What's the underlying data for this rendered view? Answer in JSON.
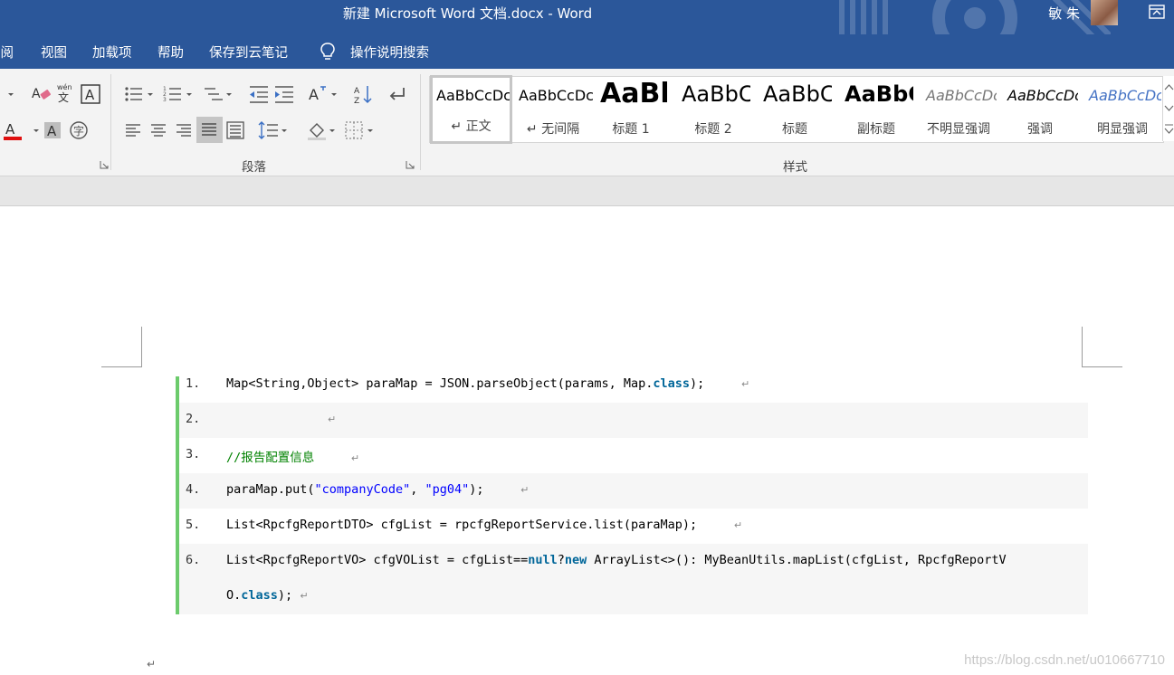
{
  "window": {
    "title": "新建 Microsoft Word 文档.docx  -  Word",
    "user": "敏 朱"
  },
  "tabs": [
    "审阅",
    "视图",
    "加载项",
    "帮助",
    "保存到云笔记",
    "操作说明搜索"
  ],
  "ribbon": {
    "paragraph_group_label": "段落",
    "styles_group_label": "样式",
    "styles": [
      {
        "preview": "AaBbCcDc",
        "name": "↵ 正文"
      },
      {
        "preview": "AaBbCcDc",
        "name": "↵ 无间隔"
      },
      {
        "preview": "AaBl",
        "name": "标题 1"
      },
      {
        "preview": "AaBbC",
        "name": "标题 2"
      },
      {
        "preview": "AaBbC",
        "name": "标题"
      },
      {
        "preview": "AaBbC",
        "name": "副标题"
      },
      {
        "preview": "AaBbCcDc",
        "name": "不明显强调"
      },
      {
        "preview": "AaBbCcDc",
        "name": "强调"
      },
      {
        "preview": "AaBbCcDc",
        "name": "明显强调"
      }
    ]
  },
  "code": {
    "accent_color": "#6ccb6c",
    "lines": [
      {
        "num": "1."
      },
      {
        "num": "2."
      },
      {
        "num": "3."
      },
      {
        "num": "4."
      },
      {
        "num": "5."
      },
      {
        "num": "6."
      }
    ],
    "tokens": {
      "l1a": "Map<String,Object> paraMap = JSON.parseObject(params, Map.",
      "l1kw": "class",
      "l1b": ");",
      "l3": "//报告配置信息",
      "l4a": "paraMap.put(",
      "l4s1": "\"companyCode\"",
      "l4b": ", ",
      "l4s2": "\"pg04\"",
      "l4c": ");",
      "l5": "List<RpcfgReportDTO> cfgList = rpcfgReportService.list(paraMap);",
      "l6a": "List<RpcfgReportVO> cfgVOList = cfgList==",
      "l6kw1": "null",
      "l6b": "?",
      "l6kw2": "new",
      "l6c": " ArrayList<>(): MyBeanUtils.mapList(cfgList, RpcfgReportV",
      "l7a": "O.",
      "l7kw": "class",
      "l7b": ");"
    },
    "para_mark": "↵"
  },
  "watermark": "https://blog.csdn.net/u010667710",
  "colors": {
    "title_bar": "#2b579a",
    "ribbon": "#f3f3f3",
    "keyword": "#006699",
    "string": "#0000ff",
    "comment": "#008200"
  }
}
